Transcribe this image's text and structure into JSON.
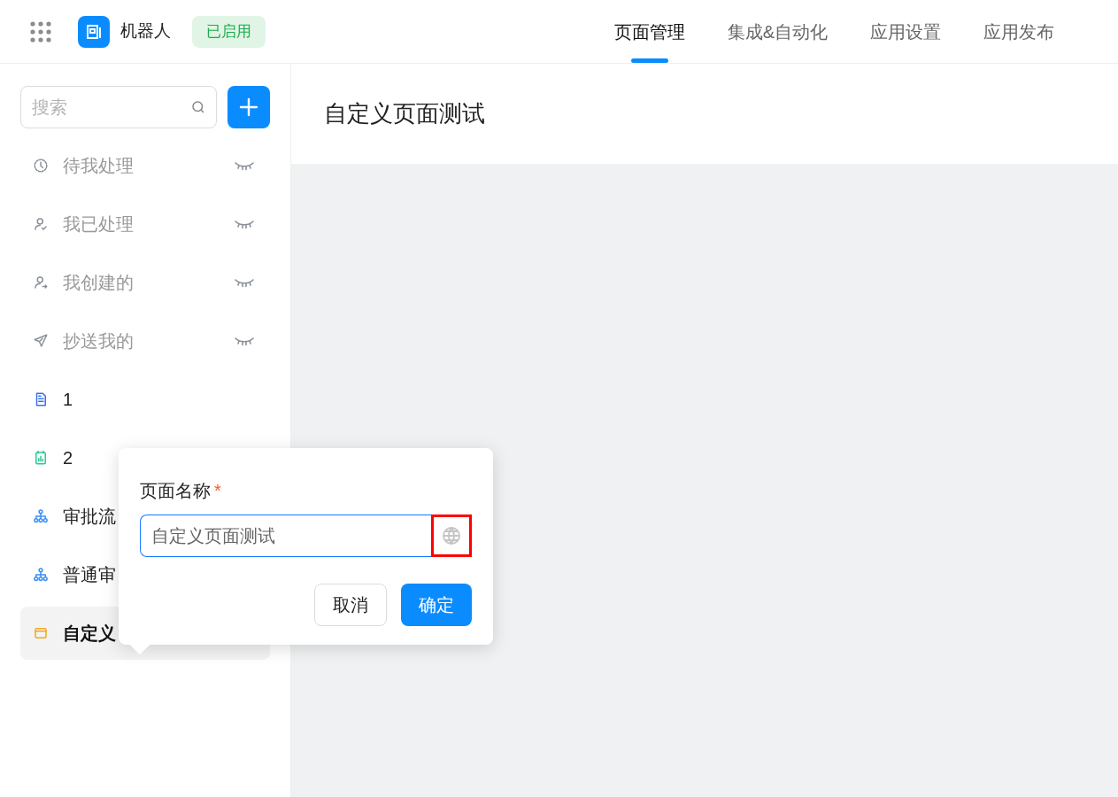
{
  "header": {
    "app_name": "机器人",
    "status_badge": "已启用",
    "tabs": [
      {
        "label": "页面管理",
        "selected": true
      },
      {
        "label": "集成&自动化",
        "selected": false
      },
      {
        "label": "应用设置",
        "selected": false
      },
      {
        "label": "应用发布",
        "selected": false
      }
    ]
  },
  "sidebar": {
    "search": {
      "placeholder": "搜索"
    },
    "items": [
      {
        "kind": "clock",
        "label": "待我处理",
        "hidden": true,
        "selected": false
      },
      {
        "kind": "user-check",
        "label": "我已处理",
        "hidden": true,
        "selected": false
      },
      {
        "kind": "user-out",
        "label": "我创建的",
        "hidden": true,
        "selected": false
      },
      {
        "kind": "send",
        "label": "抄送我的",
        "hidden": true,
        "selected": false
      },
      {
        "kind": "form",
        "label": "1",
        "hidden": false,
        "selected": false
      },
      {
        "kind": "report",
        "label": "2",
        "hidden": false,
        "selected": false
      },
      {
        "kind": "flow",
        "label": "审批流",
        "hidden": false,
        "selected": false
      },
      {
        "kind": "flow",
        "label": "普通审",
        "hidden": false,
        "selected": false
      },
      {
        "kind": "custom",
        "label": "自定义",
        "hidden": false,
        "selected": true
      }
    ]
  },
  "main": {
    "page_title": "自定义页面测试"
  },
  "rename_popover": {
    "label": "页面名称",
    "required_mark": "*",
    "value": "自定义页面测试",
    "globe_highlighted": true,
    "buttons": [
      {
        "kind": "secondary",
        "label": "取消"
      },
      {
        "kind": "primary",
        "label": "确定"
      }
    ]
  }
}
